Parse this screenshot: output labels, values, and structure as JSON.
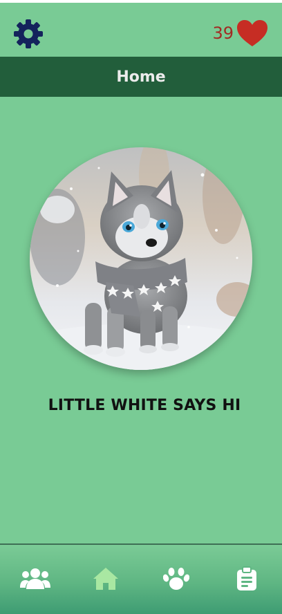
{
  "header": {
    "title": "Home"
  },
  "likes": {
    "count": "39"
  },
  "main": {
    "greeting": "LITTLE WHITE SAYS HI",
    "photo_alt": "Husky puppy wearing a starry scarf in snow"
  },
  "bottom_nav": {
    "items": [
      {
        "name": "friends",
        "icon": "users-icon",
        "active": false
      },
      {
        "name": "home",
        "icon": "home-icon",
        "active": true
      },
      {
        "name": "pets",
        "icon": "paw-icon",
        "active": false
      },
      {
        "name": "tasks",
        "icon": "clipboard-icon",
        "active": false
      }
    ]
  },
  "colors": {
    "background": "#79cb95",
    "header": "#225e3b",
    "accent_dark_blue": "#14235c",
    "heart_red": "#c62d24",
    "active_nav": "#a9e7a2",
    "inactive_nav": "#ffffff"
  }
}
